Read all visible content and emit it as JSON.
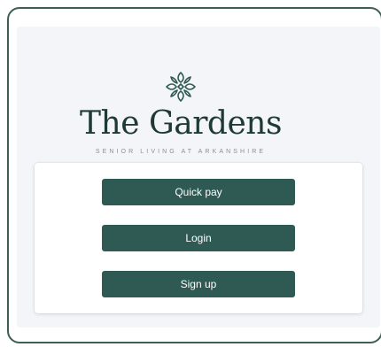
{
  "brand": {
    "name": "The Gardens",
    "tagline": "SENIOR LIVING AT ARKANSHIRE",
    "logo_icon": "ornamental-leaf-icon"
  },
  "actions": {
    "quick_pay_label": "Quick pay",
    "login_label": "Login",
    "signup_label": "Sign up"
  },
  "colors": {
    "frame_border": "#3f5f56",
    "button_bg": "#2f5a54",
    "brand_text": "#1f3a35",
    "page_bg": "#f4f5f8"
  }
}
